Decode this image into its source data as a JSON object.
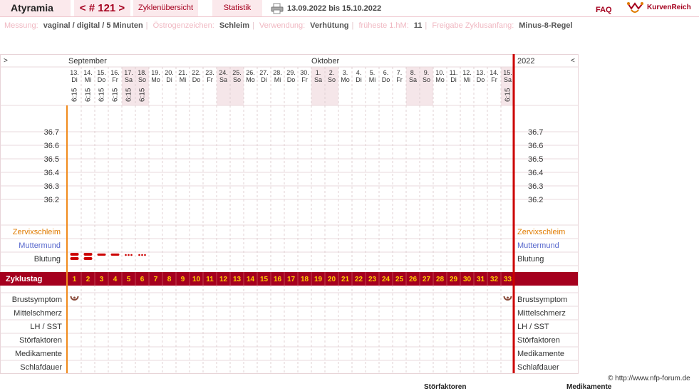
{
  "header": {
    "app": "Atyramia",
    "cycle": "< # 121 >",
    "overview": "Zyklenübersicht",
    "stats": "Statistik",
    "daterange": "13.09.2022 bis 15.10.2022",
    "faq": "FAQ",
    "brand": "KurvenReich"
  },
  "meta": [
    {
      "label": "Messung:",
      "value": "vaginal / digital / 5 Minuten"
    },
    {
      "label": "Östrogenzeichen:",
      "value": "Schleim"
    },
    {
      "label": "Verwendung:",
      "value": "Verhütung"
    },
    {
      "label": "früheste 1.hM:",
      "value": "11"
    },
    {
      "label": "Freigabe Zyklusanfang:",
      "value": "Minus-8-Regel"
    }
  ],
  "chart": {
    "nav_left": ">",
    "nav_right": "<",
    "month1": "September",
    "month2": "Oktober",
    "year": "2022",
    "dates": [
      "13.",
      "14.",
      "15.",
      "16.",
      "17.",
      "18.",
      "19.",
      "20.",
      "21.",
      "22.",
      "23.",
      "24.",
      "25.",
      "26.",
      "27.",
      "28.",
      "29.",
      "30.",
      "1.",
      "2.",
      "3.",
      "4.",
      "5.",
      "6.",
      "7.",
      "8.",
      "9.",
      "10.",
      "11.",
      "12.",
      "13.",
      "14.",
      "15."
    ],
    "weekdays": [
      "Di",
      "Mi",
      "Do",
      "Fr",
      "Sa",
      "So",
      "Mo",
      "Di",
      "Mi",
      "Do",
      "Fr",
      "Sa",
      "So",
      "Mo",
      "Di",
      "Mi",
      "Do",
      "Fr",
      "Sa",
      "So",
      "Mo",
      "Di",
      "Mi",
      "Do",
      "Fr",
      "Sa",
      "So",
      "Mo",
      "Di",
      "Mi",
      "Do",
      "Fr",
      "Sa"
    ],
    "times": [
      "6:15",
      "6:15",
      "6:15",
      "6:15",
      "6:15",
      "6:15",
      "",
      "",
      "",
      "",
      "",
      "",
      "",
      "",
      "",
      "",
      "",
      "",
      "",
      "",
      "",
      "",
      "",
      "",
      "",
      "",
      "",
      "",
      "",
      "",
      "",
      "",
      "6:15"
    ],
    "temp_labels": [
      "36.7",
      "36.6",
      "36.5",
      "36.4",
      "36.3",
      "36.2"
    ],
    "rows_top": [
      "Zervixschleim",
      "Muttermund",
      "Blutung"
    ],
    "cycle_label": "Zyklustag",
    "cycle_days": [
      "1",
      "2",
      "3",
      "4",
      "5",
      "6",
      "7",
      "8",
      "9",
      "10",
      "11",
      "12",
      "13",
      "14",
      "15",
      "16",
      "17",
      "18",
      "19",
      "20",
      "21",
      "22",
      "23",
      "24",
      "25",
      "26",
      "27",
      "28",
      "29",
      "30",
      "31",
      "32",
      "33"
    ],
    "rows_bottom": [
      "Brustsymptom",
      "Mittelschmerz",
      "LH / SST",
      "Störfaktoren",
      "Medikamente",
      "Schlafdauer"
    ],
    "bleeding": [
      "heavy",
      "heavy",
      "medium",
      "medium",
      "light",
      "light"
    ],
    "breast_symptom_days": [
      1,
      33
    ],
    "colors": {
      "accent": "#a5001e",
      "weekend": "#f5e6e9",
      "zervix": "#e07b00",
      "muttermund": "#5566cc",
      "cyclebar": "#a5001e",
      "cyclenum": "#ffcc00",
      "blood": "#cc0000"
    }
  },
  "footer": {
    "copyright": "© http://www.nfp-forum.de",
    "legend_a": "Störfaktoren",
    "legend_b": "Medikamente"
  }
}
